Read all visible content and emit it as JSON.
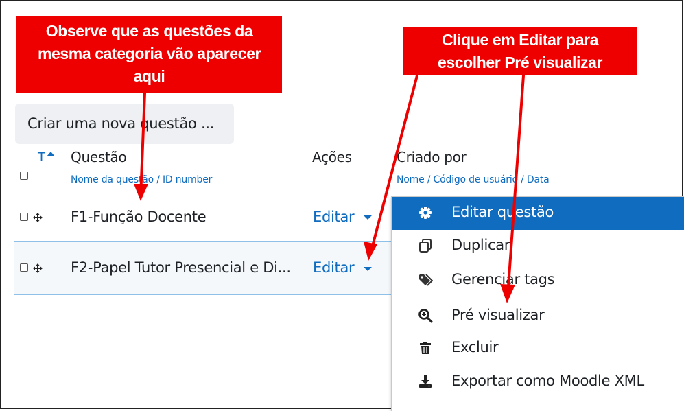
{
  "callouts": {
    "left": [
      "Observe que as questões  da",
      "mesma categoria vão aparecer",
      "aqui"
    ],
    "right": [
      "Clique em Editar para",
      "escolher  Pré visualizar"
    ]
  },
  "create_button": "Criar uma nova questão ...",
  "table": {
    "sort_label": "T",
    "col_question": "Questão",
    "col_question_sub": "Nome da questão / ID number",
    "col_actions": "Ações",
    "col_created": "Criado por",
    "col_created_sub": "Nome / Código de usuário / Data",
    "rows": [
      {
        "name": "F1-Função Docente",
        "action": "Editar"
      },
      {
        "name": "F2-Papel Tutor Presencial e Di...",
        "action": "Editar"
      }
    ]
  },
  "menu": {
    "items": [
      {
        "label": "Editar questão",
        "icon": "gear-icon"
      },
      {
        "label": "Duplicar",
        "icon": "copy-icon"
      },
      {
        "label": "Gerenciar tags",
        "icon": "tags-icon"
      },
      {
        "label": "Pré visualizar",
        "icon": "search-plus-icon"
      },
      {
        "label": "Excluir",
        "icon": "trash-icon"
      },
      {
        "label": "Exportar como Moodle XML",
        "icon": "download-icon"
      }
    ]
  },
  "colors": {
    "annotation_red": "#ee0000",
    "link_blue": "#0f6cbf",
    "selected_row_border": "#8fc1e8"
  }
}
